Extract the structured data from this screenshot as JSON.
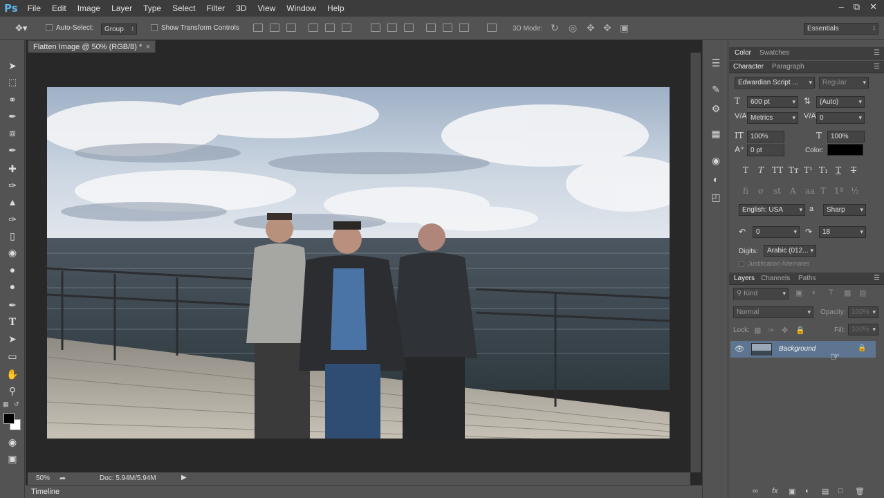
{
  "app": {
    "logo": "Ps"
  },
  "menu": [
    "File",
    "Edit",
    "Image",
    "Layer",
    "Type",
    "Select",
    "Filter",
    "3D",
    "View",
    "Window",
    "Help"
  ],
  "window_controls": [
    "–",
    "⧉",
    "✕"
  ],
  "options_bar": {
    "auto_select_label": "Auto-Select:",
    "auto_select_value": "Group",
    "show_transform_label": "Show Transform Controls",
    "mode_3d_label": "3D Mode:",
    "workspace": "Essentials"
  },
  "document": {
    "tab_title": "Flatten Image @ 50% (RGB/8) *",
    "zoom": "50%",
    "doc_info": "Doc: 5.94M/5.94M"
  },
  "timeline": {
    "label": "Timeline"
  },
  "color_panel": {
    "tabs": [
      "Color",
      "Swatches"
    ]
  },
  "character_panel": {
    "tabs": [
      "Character",
      "Paragraph"
    ],
    "font_family": "Edwardian Script ...",
    "font_style": "Regular",
    "font_size": "600 pt",
    "leading": "(Auto)",
    "kerning": "Metrics",
    "tracking": "0",
    "vertical_scale": "100%",
    "horizontal_scale": "100%",
    "baseline_shift": "0 pt",
    "color_label": "Color:",
    "color_value": "#000000",
    "language": "English: USA",
    "antialias_label": "a",
    "antialias": "Sharp",
    "diacritic_1": "0",
    "diacritic_2": "18",
    "digits_label": "Digits:",
    "digits_value": "Arabic (012...",
    "justification_label": "Justification Alternates"
  },
  "layers_panel": {
    "tabs": [
      "Layers",
      "Channels",
      "Paths"
    ],
    "kind_label": "Kind",
    "blend_mode": "Normal",
    "opacity_label": "Opacity:",
    "opacity_value": "100%",
    "lock_label": "Lock:",
    "fill_label": "Fill:",
    "fill_value": "100%",
    "layers": [
      {
        "name": "Background",
        "visible": true,
        "locked": true
      }
    ]
  },
  "colors": {
    "menubar": "#3c3c3c",
    "panel": "#535353",
    "canvas_bg": "#282828",
    "selected_layer": "#5d7590",
    "ps_blue": "#5fb1e6"
  }
}
